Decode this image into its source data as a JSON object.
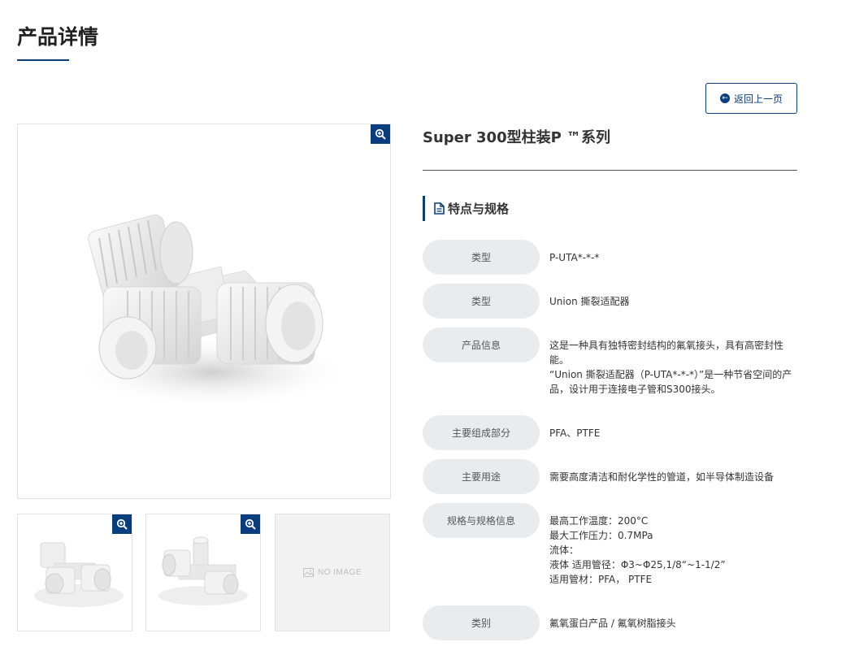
{
  "page": {
    "title": "产品详情"
  },
  "back_button": {
    "label": "返回上一页"
  },
  "product": {
    "title": "Super 300型柱装P ™系列"
  },
  "gallery": {
    "no_image_label": "NO IMAGE"
  },
  "section": {
    "heading": "特点与规格"
  },
  "specs": [
    {
      "label": "类型",
      "lines": [
        "P-UTA*-*-*"
      ]
    },
    {
      "label": "类型",
      "lines": [
        "Union 撕裂适配器"
      ]
    },
    {
      "label": "产品信息",
      "lines": [
        "这是一种具有独特密封结构的氟氧接头，具有高密封性",
        "能。",
        "“Union 撕裂适配器（P-UTA*-*-*）”是一种节省空间的产",
        "品，设计用于连接电子管和S300接头。"
      ]
    },
    {
      "label": "主要组成部分",
      "lines": [
        "PFA、PTFE"
      ]
    },
    {
      "label": "主要用途",
      "lines": [
        "需要高度清洁和耐化学性的管道，如半导体制造设备"
      ]
    },
    {
      "label": "规格与规格信息",
      "lines": [
        "最高工作温度：200°C",
        "最大工作压力：0.7MPa",
        "流体：",
        "液体 适用管径：Φ3~Φ25,1/8“~1-1/2”",
        "适用管材：PFA， PTFE"
      ]
    },
    {
      "label": "类别",
      "lines": [
        "氟氧蛋白产品 / 氟氧树脂接头"
      ]
    }
  ],
  "colors": {
    "accent": "#0a3d7e",
    "label_bg": "#e9ecef"
  },
  "icons": {
    "zoom": "zoom-in-icon",
    "back": "circle-arrow-left-icon",
    "doc": "document-icon",
    "image": "image-placeholder-icon"
  }
}
